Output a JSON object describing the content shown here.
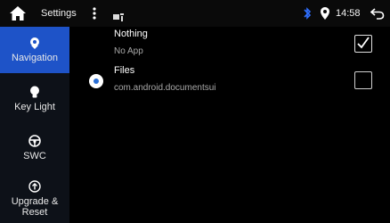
{
  "status_bar": {
    "app_title": "Settings",
    "time": "14:58",
    "icons": [
      "home-icon",
      "more-vert-icon",
      "notification-icon",
      "bluetooth-icon",
      "location-icon",
      "back-icon"
    ]
  },
  "sidebar": {
    "items": [
      {
        "label": "Navigation",
        "icon": "location-pin-icon",
        "active": true
      },
      {
        "label": "Key Light",
        "icon": "bulb-icon",
        "active": false
      },
      {
        "label": "SWC",
        "icon": "steering-wheel-icon",
        "active": false
      },
      {
        "label": "Upgrade & Reset",
        "icon": "upgrade-icon",
        "active": false
      }
    ]
  },
  "app_list": [
    {
      "title": "Nothing",
      "subtitle": "No App",
      "checked": true,
      "has_icon": false
    },
    {
      "title": "Files",
      "subtitle": "com.android.documentsui",
      "checked": false,
      "has_icon": true
    }
  ],
  "colors": {
    "accent": "#1e53c8",
    "background": "#000000",
    "sidebar": "#0d1118",
    "bluetooth": "#2f6fff"
  }
}
